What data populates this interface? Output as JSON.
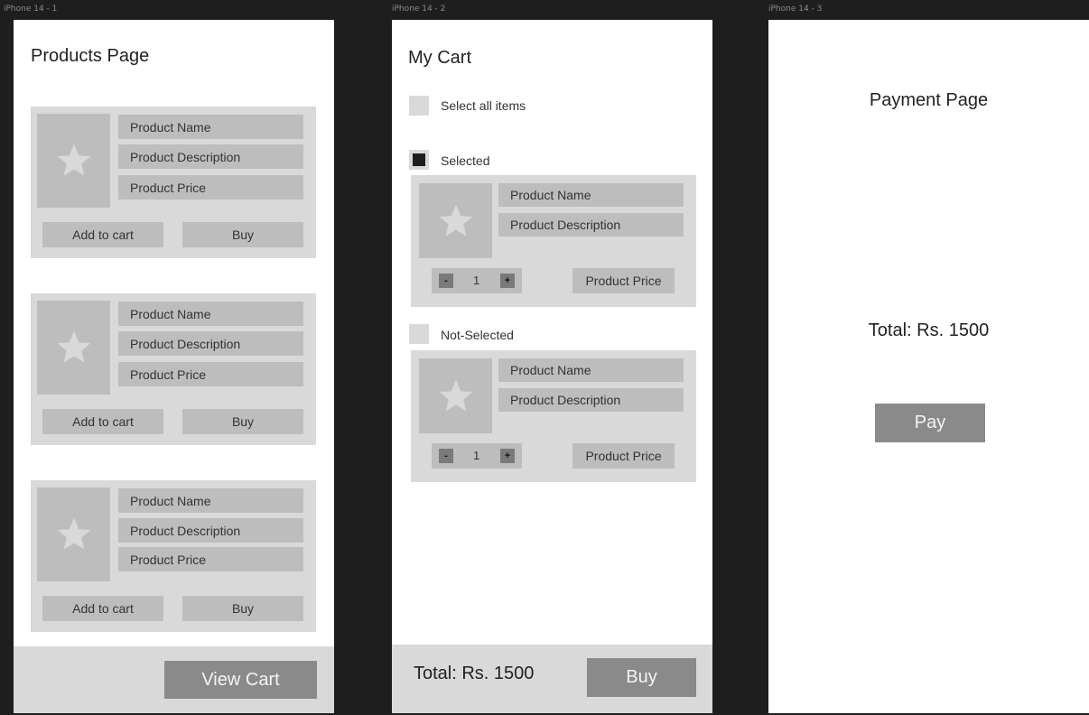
{
  "frames": [
    {
      "label": "iPhone 14 - 1"
    },
    {
      "label": "iPhone 14 - 2"
    },
    {
      "label": "iPhone 14 - 3"
    }
  ],
  "products_page": {
    "title": "Products Page",
    "cards": [
      {
        "name": "Product Name",
        "description": "Product Description",
        "price": "Product Price",
        "add_to_cart": "Add to cart",
        "buy": "Buy"
      },
      {
        "name": "Product Name",
        "description": "Product Description",
        "price": "Product Price",
        "add_to_cart": "Add to cart",
        "buy": "Buy"
      },
      {
        "name": "Product Name",
        "description": "Product Description",
        "price": "Product Price",
        "add_to_cart": "Add to cart",
        "buy": "Buy"
      }
    ],
    "view_cart": "View Cart"
  },
  "cart_page": {
    "title": "My Cart",
    "select_all": "Select all items",
    "items": [
      {
        "status": "Selected",
        "checked": true,
        "name": "Product Name",
        "description": "Product Description",
        "minus": "-",
        "quantity": "1",
        "plus": "+",
        "price": "Product Price"
      },
      {
        "status": "Not-Selected",
        "checked": false,
        "name": "Product Name",
        "description": "Product Description",
        "minus": "-",
        "quantity": "1",
        "plus": "+",
        "price": "Product Price"
      }
    ],
    "total": "Total: Rs. 1500",
    "buy": "Buy"
  },
  "payment_page": {
    "title": "Payment Page",
    "total": "Total: Rs. 1500",
    "pay": "Pay"
  },
  "colors": {
    "canvas": "#1e1e1e",
    "screen": "#ffffff",
    "card": "#d9d9d9",
    "field": "#bdbdbd",
    "button": "#8a8a8a"
  }
}
